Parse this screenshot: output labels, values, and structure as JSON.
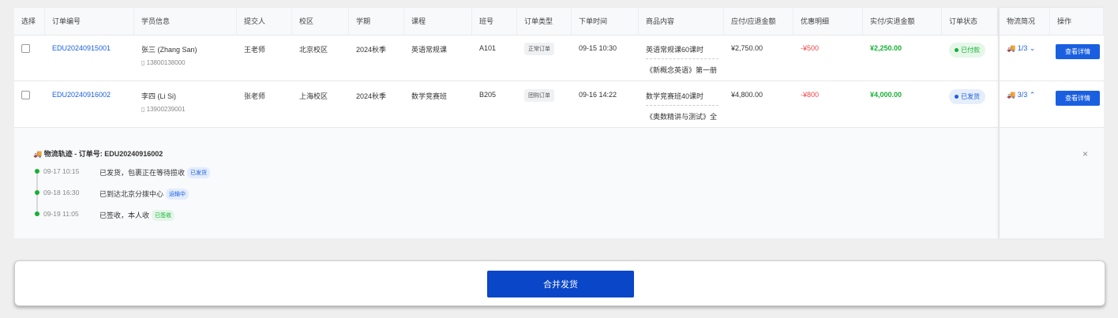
{
  "headers": [
    "选择",
    "订单编号",
    "学员信息",
    "提交人",
    "校区",
    "学期",
    "课程",
    "班号",
    "订单类型",
    "下单时间",
    "商品内容",
    "应付/应退金额",
    "优惠明细",
    "实付/实退金额",
    "订单状态"
  ],
  "fixed_headers": [
    "物流简况",
    "操作"
  ],
  "rows": [
    {
      "order_no": "EDU20240915001",
      "student": "张三 (Zhang San)",
      "phone": "13800138000",
      "submitter": "王老师",
      "campus": "北京校区",
      "term": "2024秋季",
      "course": "英语常规课",
      "class_no": "A101",
      "type": "正常订单",
      "time": "09-15 10:30",
      "goods": [
        "英语常规课60课时",
        "《新概念英语》第一册"
      ],
      "payable": "¥2,750.00",
      "discount": "-¥500",
      "actual": "¥2,250.00",
      "status": "已付款",
      "status_color": "#16b034",
      "status_bg": "#e5f7e9",
      "logistics": "1/3",
      "chevron": "⌄",
      "action": "查看详情"
    },
    {
      "order_no": "EDU20240916002",
      "student": "李四 (Li Si)",
      "phone": "13900239001",
      "submitter": "张老师",
      "campus": "上海校区",
      "term": "2024秋季",
      "course": "数学竞赛班",
      "class_no": "B205",
      "type": "团购订单",
      "time": "09-16 14:22",
      "goods": [
        "数学竞赛班40课时",
        "《奥数精讲与测试》全"
      ],
      "payable": "¥4,800.00",
      "discount": "-¥800",
      "actual": "¥4,000.00",
      "status": "已发货",
      "status_color": "#1a5fe0",
      "status_bg": "#e6eefc",
      "logistics": "3/3",
      "chevron": "⌃",
      "action": "查看详情"
    }
  ],
  "tracking": {
    "title": "物流轨迹 - 订单号: EDU20240916002",
    "close": "×",
    "events": [
      {
        "time": "09-17 10:15",
        "text": "已发货，包裹正在等待揽收",
        "badge": "已发货",
        "color": "#1a5fe0",
        "bg": "#e3ecfd"
      },
      {
        "time": "09-18 16:30",
        "text": "已到达北京分拨中心",
        "badge": "运输中",
        "color": "#1a5fe0",
        "bg": "#e3ecfd"
      },
      {
        "time": "09-19 11:05",
        "text": "已签收，本人收",
        "badge": "已签收",
        "color": "#16b034",
        "bg": "#e3f6e7"
      }
    ]
  },
  "merge_button": "合并发货"
}
